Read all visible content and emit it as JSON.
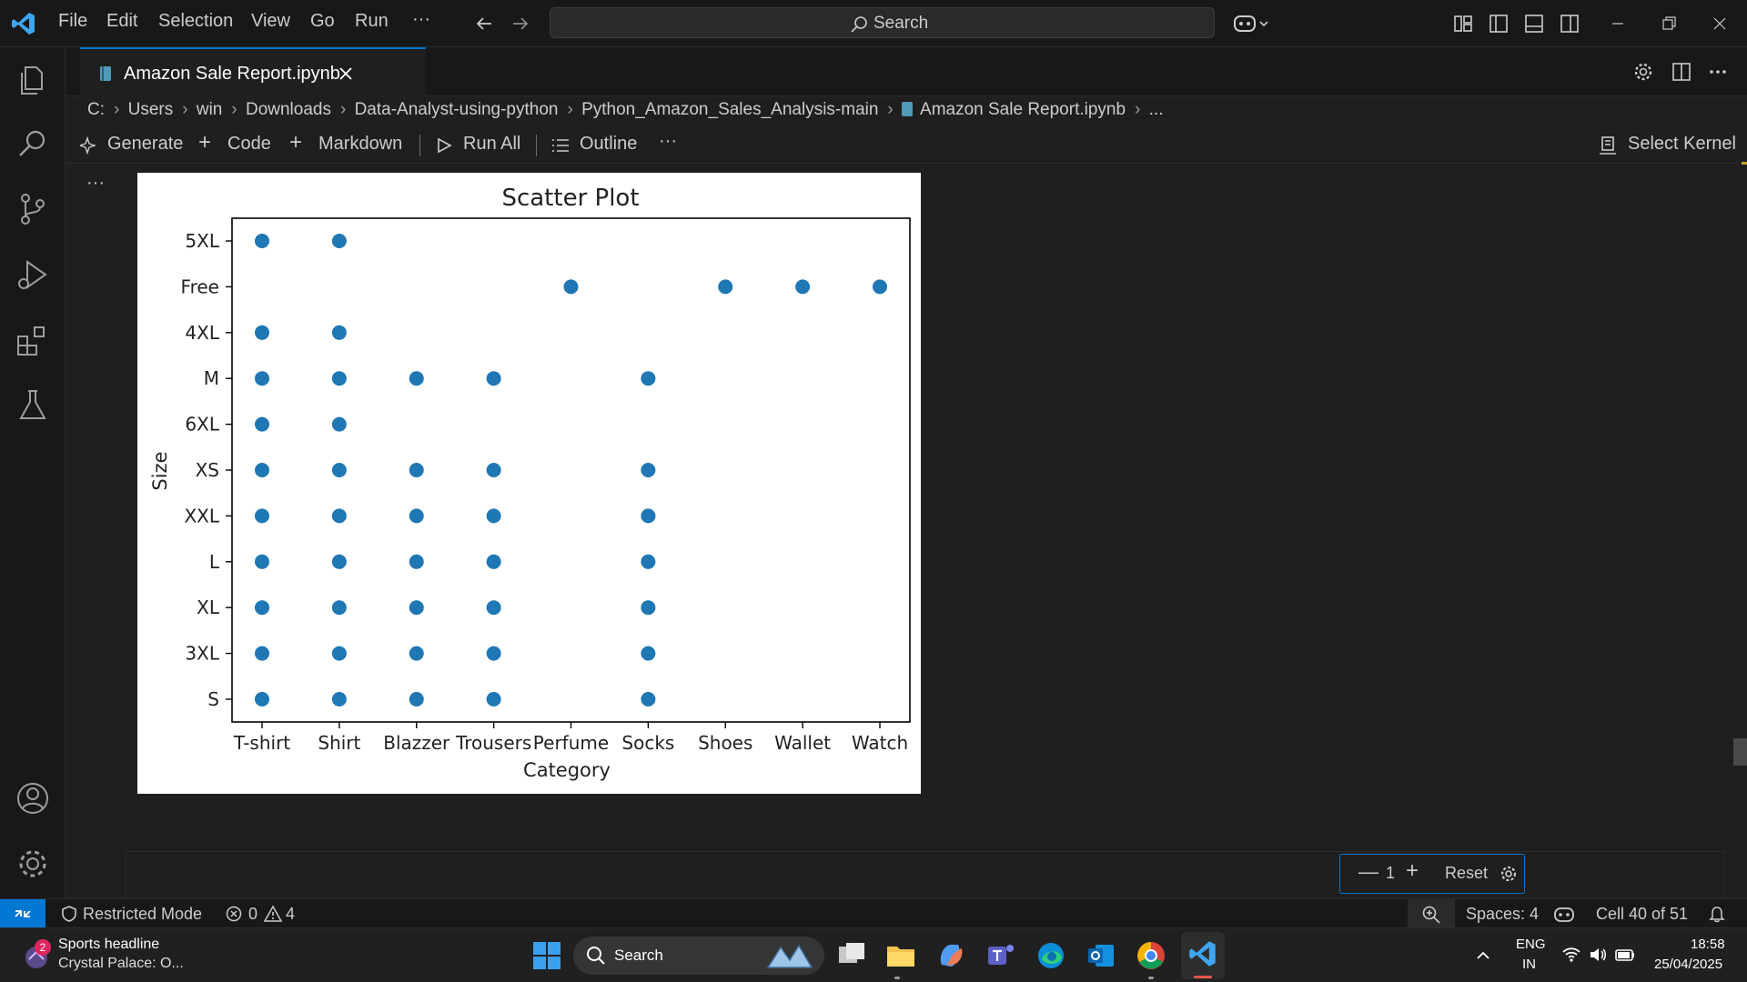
{
  "menu": {
    "items": [
      "File",
      "Edit",
      "Selection",
      "View",
      "Go",
      "Run"
    ],
    "overflow": "···"
  },
  "search": {
    "label": "Search"
  },
  "tab": {
    "filename": "Amazon Sale Report.ipynb"
  },
  "breadcrumb": [
    "C:",
    "Users",
    "win",
    "Downloads",
    "Data-Analyst-using-python",
    "Python_Amazon_Sales_Analysis-main",
    "Amazon Sale Report.ipynb",
    "..."
  ],
  "toolbar": {
    "generate": "Generate",
    "code": "Code",
    "markdown": "Markdown",
    "run_all": "Run All",
    "outline": "Outline",
    "more": "···",
    "select_kernel": "Select Kernel"
  },
  "cell_more": "···",
  "chart_data": {
    "type": "scatter",
    "title": "Scatter Plot",
    "xlabel": "Category",
    "ylabel": "Size",
    "categories": [
      "T-shirt",
      "Shirt",
      "Blazzer",
      "Trousers",
      "Perfume",
      "Socks",
      "Shoes",
      "Wallet",
      "Watch"
    ],
    "y_categories": [
      "S",
      "3XL",
      "XL",
      "L",
      "XXL",
      "XS",
      "6XL",
      "M",
      "4XL",
      "Free",
      "5XL"
    ],
    "color": "#1f77b4",
    "points": [
      [
        "T-shirt",
        "5XL"
      ],
      [
        "Shirt",
        "5XL"
      ],
      [
        "Perfume",
        "Free"
      ],
      [
        "Shoes",
        "Free"
      ],
      [
        "Wallet",
        "Free"
      ],
      [
        "Watch",
        "Free"
      ],
      [
        "T-shirt",
        "4XL"
      ],
      [
        "Shirt",
        "4XL"
      ],
      [
        "T-shirt",
        "M"
      ],
      [
        "Shirt",
        "M"
      ],
      [
        "Blazzer",
        "M"
      ],
      [
        "Trousers",
        "M"
      ],
      [
        "Socks",
        "M"
      ],
      [
        "T-shirt",
        "6XL"
      ],
      [
        "Shirt",
        "6XL"
      ],
      [
        "T-shirt",
        "XS"
      ],
      [
        "Shirt",
        "XS"
      ],
      [
        "Blazzer",
        "XS"
      ],
      [
        "Trousers",
        "XS"
      ],
      [
        "Socks",
        "XS"
      ],
      [
        "T-shirt",
        "XXL"
      ],
      [
        "Shirt",
        "XXL"
      ],
      [
        "Blazzer",
        "XXL"
      ],
      [
        "Trousers",
        "XXL"
      ],
      [
        "Socks",
        "XXL"
      ],
      [
        "T-shirt",
        "L"
      ],
      [
        "Shirt",
        "L"
      ],
      [
        "Blazzer",
        "L"
      ],
      [
        "Trousers",
        "L"
      ],
      [
        "Socks",
        "L"
      ],
      [
        "T-shirt",
        "XL"
      ],
      [
        "Shirt",
        "XL"
      ],
      [
        "Blazzer",
        "XL"
      ],
      [
        "Trousers",
        "XL"
      ],
      [
        "Socks",
        "XL"
      ],
      [
        "T-shirt",
        "3XL"
      ],
      [
        "Shirt",
        "3XL"
      ],
      [
        "Blazzer",
        "3XL"
      ],
      [
        "Trousers",
        "3XL"
      ],
      [
        "Socks",
        "3XL"
      ],
      [
        "T-shirt",
        "S"
      ],
      [
        "Shirt",
        "S"
      ],
      [
        "Blazzer",
        "S"
      ],
      [
        "Trousers",
        "S"
      ],
      [
        "Socks",
        "S"
      ]
    ]
  },
  "zoom": {
    "value": "1",
    "reset": "Reset"
  },
  "status": {
    "restricted": "Restricted Mode",
    "errors": "0",
    "warnings": "4",
    "spaces": "Spaces: 4",
    "cell": "Cell 40 of 51"
  },
  "taskbar": {
    "news_badge": "2",
    "news_title": "Sports headline",
    "news_sub": "Crystal Palace: O...",
    "search": "Search",
    "lang1": "ENG",
    "lang2": "IN",
    "time": "18:58",
    "date": "25/04/2025"
  },
  "colors": {
    "accent": "#0078d4",
    "marker": "#1f77b4"
  }
}
